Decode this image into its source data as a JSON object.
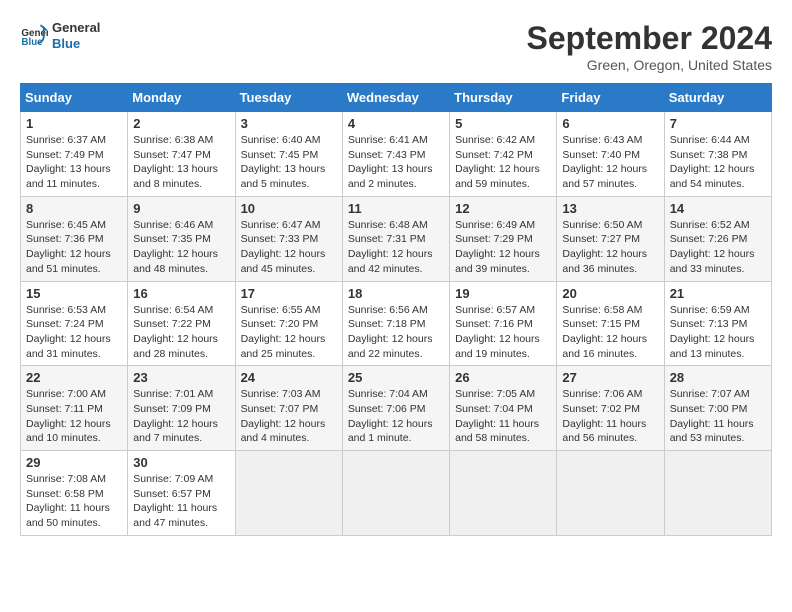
{
  "header": {
    "logo_line1": "General",
    "logo_line2": "Blue",
    "month": "September 2024",
    "location": "Green, Oregon, United States"
  },
  "weekdays": [
    "Sunday",
    "Monday",
    "Tuesday",
    "Wednesday",
    "Thursday",
    "Friday",
    "Saturday"
  ],
  "weeks": [
    [
      {
        "day": "1",
        "rise": "6:37 AM",
        "set": "7:49 PM",
        "daylight": "13 hours and 11 minutes."
      },
      {
        "day": "2",
        "rise": "6:38 AM",
        "set": "7:47 PM",
        "daylight": "13 hours and 8 minutes."
      },
      {
        "day": "3",
        "rise": "6:40 AM",
        "set": "7:45 PM",
        "daylight": "13 hours and 5 minutes."
      },
      {
        "day": "4",
        "rise": "6:41 AM",
        "set": "7:43 PM",
        "daylight": "13 hours and 2 minutes."
      },
      {
        "day": "5",
        "rise": "6:42 AM",
        "set": "7:42 PM",
        "daylight": "12 hours and 59 minutes."
      },
      {
        "day": "6",
        "rise": "6:43 AM",
        "set": "7:40 PM",
        "daylight": "12 hours and 57 minutes."
      },
      {
        "day": "7",
        "rise": "6:44 AM",
        "set": "7:38 PM",
        "daylight": "12 hours and 54 minutes."
      }
    ],
    [
      {
        "day": "8",
        "rise": "6:45 AM",
        "set": "7:36 PM",
        "daylight": "12 hours and 51 minutes."
      },
      {
        "day": "9",
        "rise": "6:46 AM",
        "set": "7:35 PM",
        "daylight": "12 hours and 48 minutes."
      },
      {
        "day": "10",
        "rise": "6:47 AM",
        "set": "7:33 PM",
        "daylight": "12 hours and 45 minutes."
      },
      {
        "day": "11",
        "rise": "6:48 AM",
        "set": "7:31 PM",
        "daylight": "12 hours and 42 minutes."
      },
      {
        "day": "12",
        "rise": "6:49 AM",
        "set": "7:29 PM",
        "daylight": "12 hours and 39 minutes."
      },
      {
        "day": "13",
        "rise": "6:50 AM",
        "set": "7:27 PM",
        "daylight": "12 hours and 36 minutes."
      },
      {
        "day": "14",
        "rise": "6:52 AM",
        "set": "7:26 PM",
        "daylight": "12 hours and 33 minutes."
      }
    ],
    [
      {
        "day": "15",
        "rise": "6:53 AM",
        "set": "7:24 PM",
        "daylight": "12 hours and 31 minutes."
      },
      {
        "day": "16",
        "rise": "6:54 AM",
        "set": "7:22 PM",
        "daylight": "12 hours and 28 minutes."
      },
      {
        "day": "17",
        "rise": "6:55 AM",
        "set": "7:20 PM",
        "daylight": "12 hours and 25 minutes."
      },
      {
        "day": "18",
        "rise": "6:56 AM",
        "set": "7:18 PM",
        "daylight": "12 hours and 22 minutes."
      },
      {
        "day": "19",
        "rise": "6:57 AM",
        "set": "7:16 PM",
        "daylight": "12 hours and 19 minutes."
      },
      {
        "day": "20",
        "rise": "6:58 AM",
        "set": "7:15 PM",
        "daylight": "12 hours and 16 minutes."
      },
      {
        "day": "21",
        "rise": "6:59 AM",
        "set": "7:13 PM",
        "daylight": "12 hours and 13 minutes."
      }
    ],
    [
      {
        "day": "22",
        "rise": "7:00 AM",
        "set": "7:11 PM",
        "daylight": "12 hours and 10 minutes."
      },
      {
        "day": "23",
        "rise": "7:01 AM",
        "set": "7:09 PM",
        "daylight": "12 hours and 7 minutes."
      },
      {
        "day": "24",
        "rise": "7:03 AM",
        "set": "7:07 PM",
        "daylight": "12 hours and 4 minutes."
      },
      {
        "day": "25",
        "rise": "7:04 AM",
        "set": "7:06 PM",
        "daylight": "12 hours and 1 minute."
      },
      {
        "day": "26",
        "rise": "7:05 AM",
        "set": "7:04 PM",
        "daylight": "11 hours and 58 minutes."
      },
      {
        "day": "27",
        "rise": "7:06 AM",
        "set": "7:02 PM",
        "daylight": "11 hours and 56 minutes."
      },
      {
        "day": "28",
        "rise": "7:07 AM",
        "set": "7:00 PM",
        "daylight": "11 hours and 53 minutes."
      }
    ],
    [
      {
        "day": "29",
        "rise": "7:08 AM",
        "set": "6:58 PM",
        "daylight": "11 hours and 50 minutes."
      },
      {
        "day": "30",
        "rise": "7:09 AM",
        "set": "6:57 PM",
        "daylight": "11 hours and 47 minutes."
      },
      null,
      null,
      null,
      null,
      null
    ]
  ]
}
